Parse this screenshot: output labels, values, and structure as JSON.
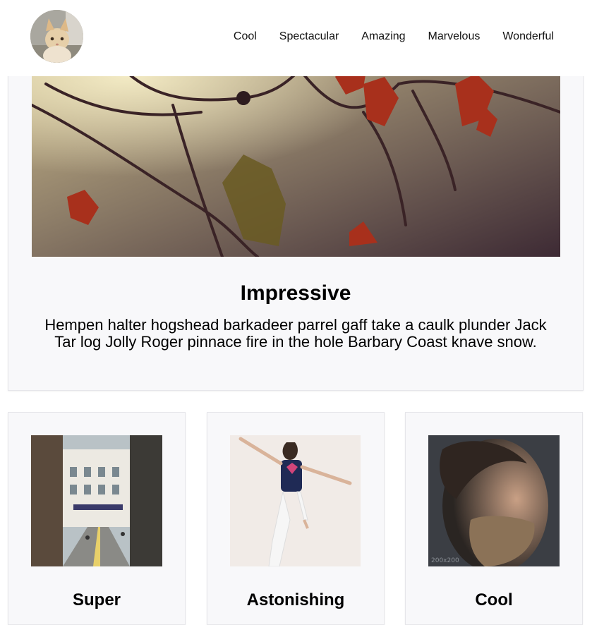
{
  "header": {
    "avatar_alt": "Kitten avatar",
    "nav": [
      "Cool",
      "Spectacular",
      "Amazing",
      "Marvelous",
      "Wonderful"
    ]
  },
  "hero": {
    "image_alt": "Autumn leaves on branches",
    "title": "Impressive",
    "text": "Hempen halter hogshead barkadeer parrel gaff take a caulk plunder Jack Tar log Jolly Roger pinnace fire in the hole Barbary Coast knave snow."
  },
  "cards": [
    {
      "title": "Super",
      "image_alt": "City street"
    },
    {
      "title": "Astonishing",
      "image_alt": "Woman jumping"
    },
    {
      "title": "Cool",
      "image_alt": "Bearded man portrait",
      "image_caption": "200x200"
    }
  ]
}
